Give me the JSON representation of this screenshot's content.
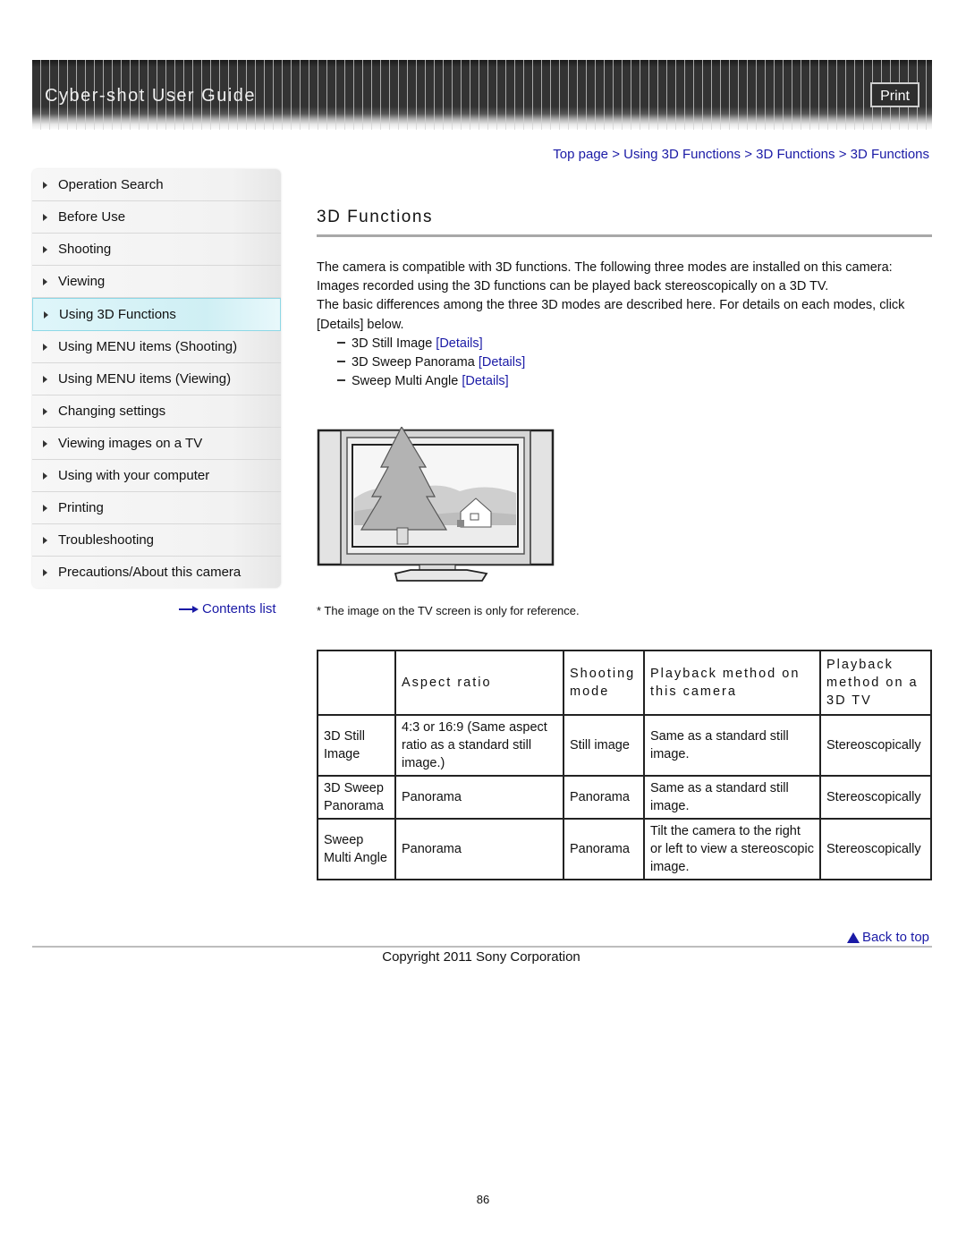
{
  "header": {
    "title": "Cyber-shot User Guide",
    "print_label": "Print"
  },
  "breadcrumb": {
    "items": [
      "Top page",
      "Using 3D Functions",
      "3D Functions",
      "3D Functions"
    ],
    "separator": ">"
  },
  "sidebar": {
    "items": [
      {
        "label": "Operation Search",
        "active": false
      },
      {
        "label": "Before Use",
        "active": false
      },
      {
        "label": "Shooting",
        "active": false
      },
      {
        "label": "Viewing",
        "active": false
      },
      {
        "label": "Using 3D Functions",
        "active": true
      },
      {
        "label": "Using MENU items (Shooting)",
        "active": false
      },
      {
        "label": "Using MENU items (Viewing)",
        "active": false
      },
      {
        "label": "Changing settings",
        "active": false
      },
      {
        "label": "Viewing images on a TV",
        "active": false
      },
      {
        "label": "Using with your computer",
        "active": false
      },
      {
        "label": "Printing",
        "active": false
      },
      {
        "label": "Troubleshooting",
        "active": false
      },
      {
        "label": "Precautions/About this camera",
        "active": false
      }
    ],
    "contents_list_label": "Contents list"
  },
  "main": {
    "title": "3D Functions",
    "paragraphs": [
      "The camera is compatible with 3D functions. The following three modes are installed on this camera:",
      "Images recorded using the 3D functions can be played back stereoscopically on a 3D TV.",
      "The basic differences among the three 3D modes are described here. For details on each modes, click [Details] below."
    ],
    "modes": [
      {
        "name": "3D Still Image",
        "link": "[Details]"
      },
      {
        "name": "3D Sweep Panorama",
        "link": "[Details]"
      },
      {
        "name": "Sweep Multi Angle",
        "link": "[Details]"
      }
    ],
    "image_alt": "TV with tree and house illustration",
    "image_note": "* The image on the TV screen is only for reference."
  },
  "table": {
    "headers": [
      "",
      "Aspect ratio",
      "Shooting mode",
      "Playback method on this camera",
      "Playback method on a 3D TV"
    ],
    "rows": [
      [
        "3D Still Image",
        "4:3 or 16:9 (Same aspect ratio as a standard still image.)",
        "Still image",
        "Same as a standard still image.",
        "Stereoscopically"
      ],
      [
        "3D Sweep Panorama",
        "Panorama",
        "Panorama",
        "Same as a standard still image.",
        "Stereoscopically"
      ],
      [
        "Sweep Multi Angle",
        "Panorama",
        "Panorama",
        "Tilt the camera to the right or left to view a stereoscopic image.",
        "Stereoscopically"
      ]
    ]
  },
  "footer": {
    "back_to_top": "Back to top",
    "copyright": "Copyright 2011 Sony Corporation",
    "page_number": "86"
  },
  "colors": {
    "link": "#1a1aa6",
    "active_item_bg": "#cfeff4",
    "banner_bg": "#333333"
  }
}
